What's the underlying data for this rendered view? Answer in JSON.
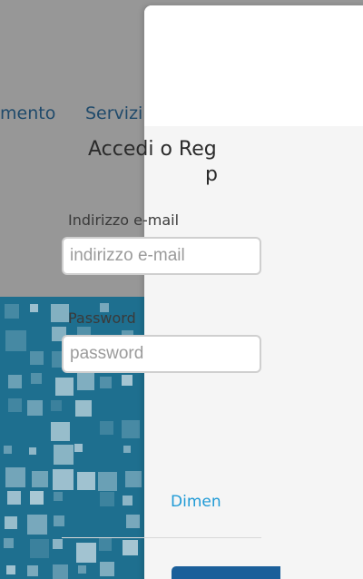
{
  "background_page": {
    "nav_items": [
      "mento",
      "Servizi"
    ]
  },
  "modal": {
    "title_line_1": "Accedi o Reg",
    "title_line_2": "p",
    "email": {
      "label": "Indirizzo e-mail",
      "placeholder": "indirizzo e-mail",
      "value": ""
    },
    "password": {
      "label": "Password",
      "placeholder": "password",
      "value": ""
    },
    "forgot_link": "Dimen"
  },
  "colors": {
    "overlay": "#979797",
    "nav_text": "#1f4a6b",
    "pattern_bg": "#1e6f8f",
    "link": "#1f9ad6",
    "primary_button": "#1b5f9a"
  }
}
